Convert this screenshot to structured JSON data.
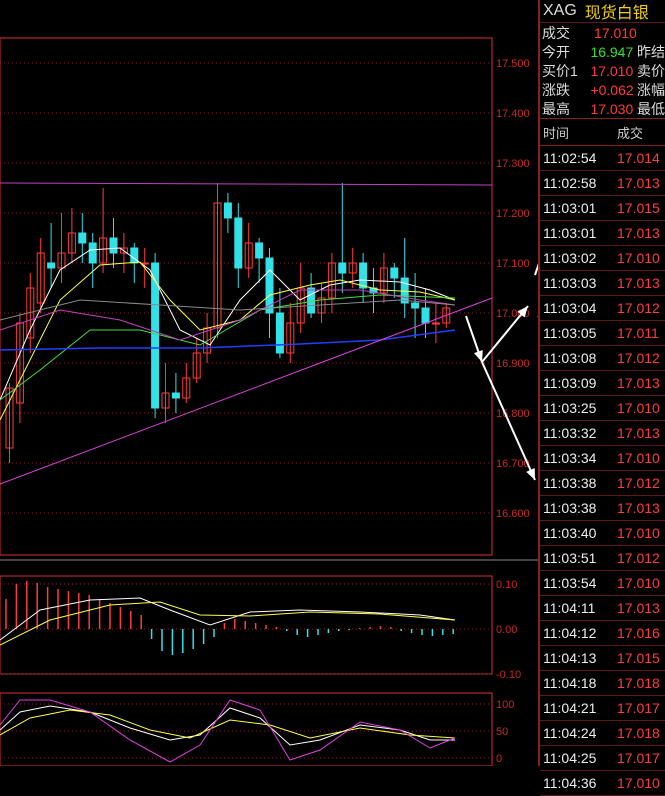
{
  "quote": {
    "symbol": "XAG",
    "name": "现货白银",
    "rows": [
      {
        "label": "成交",
        "value": "17.010",
        "color": "up",
        "extra": ""
      },
      {
        "label": "今开",
        "value": "16.947",
        "color": "dn",
        "extra": "昨结"
      },
      {
        "label": "买价1",
        "value": "17.010",
        "color": "up",
        "extra": "卖价"
      },
      {
        "label": "涨跌",
        "value": "+0.062",
        "color": "up",
        "extra": "涨幅"
      },
      {
        "label": "最高",
        "value": "17.030",
        "color": "up",
        "extra": "最低"
      }
    ]
  },
  "ticks_header": {
    "time": "时间",
    "price": "成交"
  },
  "ticks": [
    {
      "time": "11:02:54",
      "price": "17.014"
    },
    {
      "time": "11:02:58",
      "price": "17.013"
    },
    {
      "time": "11:03:01",
      "price": "17.015"
    },
    {
      "time": "11:03:01",
      "price": "17.013"
    },
    {
      "time": "11:03:02",
      "price": "17.010"
    },
    {
      "time": "11:03:03",
      "price": "17.013"
    },
    {
      "time": "11:03:04",
      "price": "17.012"
    },
    {
      "time": "11:03:05",
      "price": "17.011"
    },
    {
      "time": "11:03:08",
      "price": "17.012"
    },
    {
      "time": "11:03:09",
      "price": "17.013"
    },
    {
      "time": "11:03:25",
      "price": "17.010"
    },
    {
      "time": "11:03:32",
      "price": "17.013"
    },
    {
      "time": "11:03:34",
      "price": "17.010"
    },
    {
      "time": "11:03:38",
      "price": "17.012"
    },
    {
      "time": "11:03:38",
      "price": "17.013"
    },
    {
      "time": "11:03:40",
      "price": "17.010"
    },
    {
      "time": "11:03:51",
      "price": "17.012"
    },
    {
      "time": "11:03:54",
      "price": "17.010"
    },
    {
      "time": "11:04:11",
      "price": "17.013"
    },
    {
      "time": "11:04:12",
      "price": "17.016"
    },
    {
      "time": "11:04:13",
      "price": "17.015"
    },
    {
      "time": "11:04:18",
      "price": "17.018"
    },
    {
      "time": "11:04:21",
      "price": "17.017"
    },
    {
      "time": "11:04:24",
      "price": "17.018"
    },
    {
      "time": "11:04:25",
      "price": "17.017"
    },
    {
      "time": "11:04:36",
      "price": "17.010"
    }
  ],
  "price_axis": [
    "17.500",
    "17.400",
    "17.300",
    "17.200",
    "17.100",
    "17.000",
    "16.900",
    "16.800",
    "16.700",
    "16.600"
  ],
  "macd_axis": [
    "0.10",
    "0.00",
    "-0.10"
  ],
  "kdj_axis": [
    "100",
    "50",
    "0"
  ],
  "colors": {
    "up": "#ff3b3b",
    "down": "#32e0e8",
    "grid": "#8a1f1f",
    "axis_text": "#c82828",
    "border": "#d83030"
  }
}
